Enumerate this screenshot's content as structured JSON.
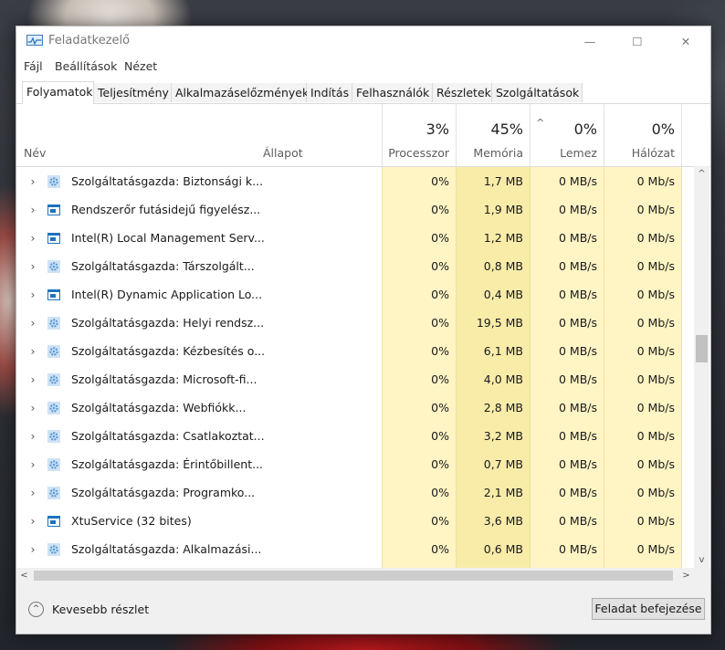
{
  "window": {
    "title": "Feladatkezelő",
    "caption_minimize": "—",
    "caption_maximize": "☐",
    "caption_close": "✕"
  },
  "menu": [
    "Fájl",
    "Beállítások",
    "Nézet"
  ],
  "tabs": [
    "Folyamatok",
    "Teljesítmény",
    "Alkalmazáselőzmények",
    "Indítás",
    "Felhasználók",
    "Részletek",
    "Szolgáltatások"
  ],
  "active_tab": "Folyamatok",
  "columns": {
    "name": "Név",
    "status": "Állapot",
    "cpu": {
      "percent": "3%",
      "label": "Processzor"
    },
    "memory": {
      "percent": "45%",
      "label": "Memória"
    },
    "disk": {
      "percent": "0%",
      "label": "Lemez"
    },
    "network": {
      "percent": "0%",
      "label": "Hálózat"
    }
  },
  "processes": [
    {
      "expand": "›",
      "icon": "gear-icon",
      "name": "Szolgáltatásgazda: Biztonsági k...",
      "cpu": "0%",
      "memory": "1,7 MB",
      "disk": "0 MB/s",
      "network": "0 Mb/s"
    },
    {
      "expand": "›",
      "icon": "window-icon",
      "name": "Rendszerőr futásidejű figyelész...",
      "cpu": "0%",
      "memory": "1,9 MB",
      "disk": "0 MB/s",
      "network": "0 Mb/s"
    },
    {
      "expand": "›",
      "icon": "window-icon",
      "name": "Intel(R) Local Management Serv...",
      "cpu": "0%",
      "memory": "1,2 MB",
      "disk": "0 MB/s",
      "network": "0 Mb/s"
    },
    {
      "expand": "›",
      "icon": "gear-icon",
      "name": "Szolgáltatásgazda: Társzolgált...",
      "cpu": "0%",
      "memory": "0,8 MB",
      "disk": "0 MB/s",
      "network": "0 Mb/s"
    },
    {
      "expand": "›",
      "icon": "window-icon",
      "name": "Intel(R) Dynamic Application Lo...",
      "cpu": "0%",
      "memory": "0,4 MB",
      "disk": "0 MB/s",
      "network": "0 Mb/s"
    },
    {
      "expand": "›",
      "icon": "gear-icon",
      "name": "Szolgáltatásgazda: Helyi rendsz...",
      "cpu": "0%",
      "memory": "19,5 MB",
      "disk": "0 MB/s",
      "network": "0 Mb/s"
    },
    {
      "expand": "›",
      "icon": "gear-icon",
      "name": "Szolgáltatásgazda: Kézbesítés o...",
      "cpu": "0%",
      "memory": "6,1 MB",
      "disk": "0 MB/s",
      "network": "0 Mb/s"
    },
    {
      "expand": "›",
      "icon": "gear-icon",
      "name": "Szolgáltatásgazda: Microsoft-fi...",
      "cpu": "0%",
      "memory": "4,0 MB",
      "disk": "0 MB/s",
      "network": "0 Mb/s"
    },
    {
      "expand": "›",
      "icon": "gear-icon",
      "name": "Szolgáltatásgazda: Webfiókk...",
      "cpu": "0%",
      "memory": "2,8 MB",
      "disk": "0 MB/s",
      "network": "0 Mb/s"
    },
    {
      "expand": "›",
      "icon": "gear-icon",
      "name": "Szolgáltatásgazda: Csatlakoztat...",
      "cpu": "0%",
      "memory": "3,2 MB",
      "disk": "0 MB/s",
      "network": "0 Mb/s"
    },
    {
      "expand": "›",
      "icon": "gear-icon",
      "name": "Szolgáltatásgazda: Érintőbillent...",
      "cpu": "0%",
      "memory": "0,7 MB",
      "disk": "0 MB/s",
      "network": "0 Mb/s"
    },
    {
      "expand": "›",
      "icon": "gear-icon",
      "name": "Szolgáltatásgazda: Programko...",
      "cpu": "0%",
      "memory": "2,1 MB",
      "disk": "0 MB/s",
      "network": "0 Mb/s"
    },
    {
      "expand": "›",
      "icon": "window-icon",
      "name": "XtuService (32 bites)",
      "cpu": "0%",
      "memory": "3,6 MB",
      "disk": "0 MB/s",
      "network": "0 Mb/s"
    },
    {
      "expand": "›",
      "icon": "gear-icon",
      "name": "Szolgáltatásgazda: Alkalmazási...",
      "cpu": "0%",
      "memory": "0,6 MB",
      "disk": "0 MB/s",
      "network": "0 Mb/s"
    }
  ],
  "footer": {
    "fewer_details": "Kevesebb részlet",
    "end_task": "Feladat befejezése"
  },
  "colors": {
    "heat_light": "#fff4c4",
    "heat_mid": "#f9eca8",
    "gear_blue": "#5b9bd5",
    "window_blue": "#1e73be"
  }
}
